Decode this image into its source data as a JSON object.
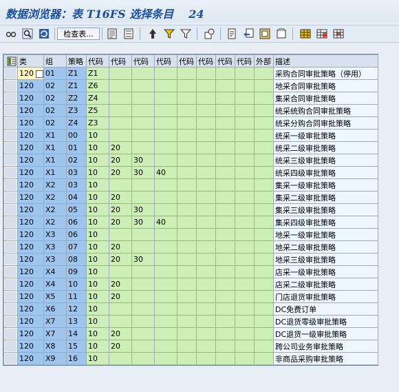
{
  "title": {
    "label": "数据浏览器：表 T16FS 选择条目",
    "count": "24"
  },
  "toolbar": {
    "check_table_label": "检查表..."
  },
  "table": {
    "columns": [
      "类",
      "组",
      "策略",
      "代码",
      "代码",
      "代码",
      "代码",
      "代码",
      "代码",
      "代码",
      "代码",
      "外部",
      "描述"
    ],
    "rows": [
      [
        "120",
        "01",
        "Z1",
        "Z1",
        "",
        "",
        "",
        "",
        "",
        "",
        "",
        "",
        "采购合同审批策略（停用）"
      ],
      [
        "120",
        "02",
        "Z1",
        "Z6",
        "",
        "",
        "",
        "",
        "",
        "",
        "",
        "",
        "地采合同审批策略"
      ],
      [
        "120",
        "02",
        "Z2",
        "Z4",
        "",
        "",
        "",
        "",
        "",
        "",
        "",
        "",
        "集采合同审批策略"
      ],
      [
        "120",
        "02",
        "Z3",
        "Z5",
        "",
        "",
        "",
        "",
        "",
        "",
        "",
        "",
        "统采统购合同审批策略"
      ],
      [
        "120",
        "02",
        "Z4",
        "Z3",
        "",
        "",
        "",
        "",
        "",
        "",
        "",
        "",
        "统采分购合同审批策略"
      ],
      [
        "120",
        "X1",
        "00",
        "10",
        "",
        "",
        "",
        "",
        "",
        "",
        "",
        "",
        "统采一级审批策略"
      ],
      [
        "120",
        "X1",
        "01",
        "10",
        "20",
        "",
        "",
        "",
        "",
        "",
        "",
        "",
        "统采二级审批策略"
      ],
      [
        "120",
        "X1",
        "02",
        "10",
        "20",
        "30",
        "",
        "",
        "",
        "",
        "",
        "",
        "统采三级审批策略"
      ],
      [
        "120",
        "X1",
        "03",
        "10",
        "20",
        "30",
        "40",
        "",
        "",
        "",
        "",
        "",
        "统采四级审批策略"
      ],
      [
        "120",
        "X2",
        "03",
        "10",
        "",
        "",
        "",
        "",
        "",
        "",
        "",
        "",
        "集采一级审批策略"
      ],
      [
        "120",
        "X2",
        "04",
        "10",
        "20",
        "",
        "",
        "",
        "",
        "",
        "",
        "",
        "集采二级审批策略"
      ],
      [
        "120",
        "X2",
        "05",
        "10",
        "20",
        "30",
        "",
        "",
        "",
        "",
        "",
        "",
        "集采三级审批策略"
      ],
      [
        "120",
        "X2",
        "06",
        "10",
        "20",
        "30",
        "40",
        "",
        "",
        "",
        "",
        "",
        "集采四级审批策略"
      ],
      [
        "120",
        "X3",
        "06",
        "10",
        "",
        "",
        "",
        "",
        "",
        "",
        "",
        "",
        "地采一级审批策略"
      ],
      [
        "120",
        "X3",
        "07",
        "10",
        "20",
        "",
        "",
        "",
        "",
        "",
        "",
        "",
        "地采二级审批策略"
      ],
      [
        "120",
        "X3",
        "08",
        "10",
        "20",
        "30",
        "",
        "",
        "",
        "",
        "",
        "",
        "地采三级审批策略"
      ],
      [
        "120",
        "X4",
        "09",
        "10",
        "",
        "",
        "",
        "",
        "",
        "",
        "",
        "",
        "店采一级审批策略"
      ],
      [
        "120",
        "X4",
        "10",
        "10",
        "20",
        "",
        "",
        "",
        "",
        "",
        "",
        "",
        "店采二级审批策略"
      ],
      [
        "120",
        "X5",
        "11",
        "10",
        "20",
        "",
        "",
        "",
        "",
        "",
        "",
        "",
        "门店退货审批策略"
      ],
      [
        "120",
        "X6",
        "12",
        "10",
        "",
        "",
        "",
        "",
        "",
        "",
        "",
        "",
        "DC免费订单"
      ],
      [
        "120",
        "X7",
        "13",
        "10",
        "",
        "",
        "",
        "",
        "",
        "",
        "",
        "",
        "DC退货零级审批策略"
      ],
      [
        "120",
        "X7",
        "14",
        "10",
        "20",
        "",
        "",
        "",
        "",
        "",
        "",
        "",
        "DC退货一级审批策略"
      ],
      [
        "120",
        "X8",
        "15",
        "10",
        "20",
        "",
        "",
        "",
        "",
        "",
        "",
        "",
        "跨公司业务审批策略"
      ],
      [
        "120",
        "X9",
        "16",
        "10",
        "",
        "",
        "",
        "",
        "",
        "",
        "",
        "",
        "非商品采购审批策略"
      ]
    ]
  },
  "icons": {
    "toolbar": [
      "glasses-icon",
      "find-icon",
      "refresh-icon",
      "check-table-button",
      "details-icon",
      "sort-asc-icon",
      "sort-desc-icon",
      "filter-icon",
      "filter-set-icon",
      "abc-analysis-icon",
      "export-icon",
      "import-icon",
      "print-icon",
      "layout-icon",
      "grid-icon",
      "grid-split-icon",
      "grid-merge-icon"
    ],
    "corner": "select-all-icon"
  }
}
